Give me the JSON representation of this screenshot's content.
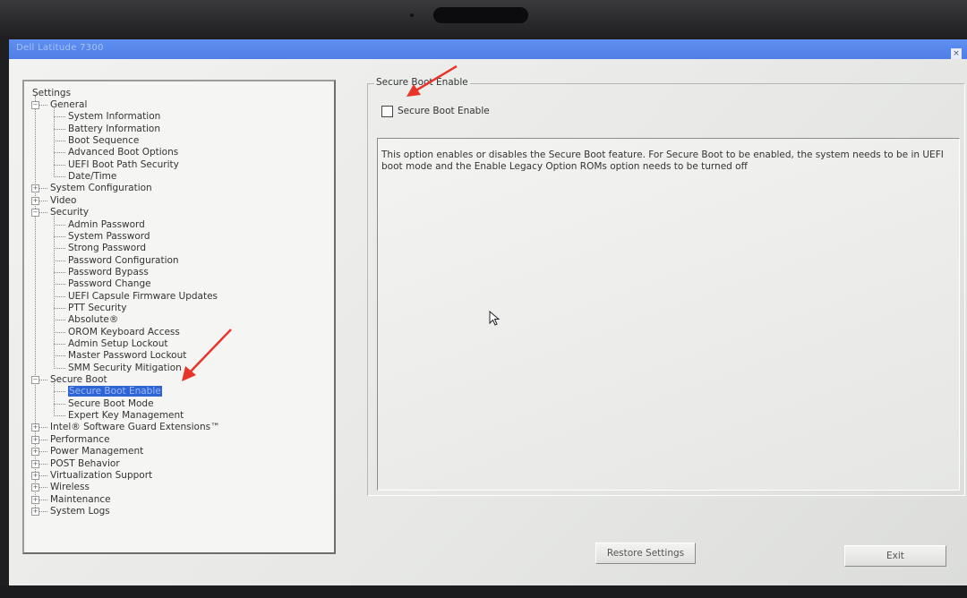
{
  "window": {
    "title": "Dell Latitude 7300"
  },
  "tree": {
    "root_label": "Settings",
    "items": [
      {
        "label": "General",
        "level": 1,
        "expander": "−"
      },
      {
        "label": "System Information",
        "level": 2
      },
      {
        "label": "Battery Information",
        "level": 2
      },
      {
        "label": "Boot Sequence",
        "level": 2
      },
      {
        "label": "Advanced Boot Options",
        "level": 2
      },
      {
        "label": "UEFI Boot Path Security",
        "level": 2
      },
      {
        "label": "Date/Time",
        "level": 2
      },
      {
        "label": "System Configuration",
        "level": 1,
        "expander": "+"
      },
      {
        "label": "Video",
        "level": 1,
        "expander": "+"
      },
      {
        "label": "Security",
        "level": 1,
        "expander": "−"
      },
      {
        "label": "Admin Password",
        "level": 2
      },
      {
        "label": "System Password",
        "level": 2
      },
      {
        "label": "Strong Password",
        "level": 2
      },
      {
        "label": "Password Configuration",
        "level": 2
      },
      {
        "label": "Password Bypass",
        "level": 2
      },
      {
        "label": "Password Change",
        "level": 2
      },
      {
        "label": "UEFI Capsule Firmware Updates",
        "level": 2
      },
      {
        "label": "PTT Security",
        "level": 2
      },
      {
        "label": "Absolute®",
        "level": 2
      },
      {
        "label": "OROM Keyboard Access",
        "level": 2
      },
      {
        "label": "Admin Setup Lockout",
        "level": 2
      },
      {
        "label": "Master Password Lockout",
        "level": 2
      },
      {
        "label": "SMM Security Mitigation",
        "level": 2
      },
      {
        "label": "Secure Boot",
        "level": 1,
        "expander": "−"
      },
      {
        "label": "Secure Boot Enable",
        "level": 2,
        "selected": true
      },
      {
        "label": "Secure Boot Mode",
        "level": 2
      },
      {
        "label": "Expert Key Management",
        "level": 2
      },
      {
        "label": "Intel® Software Guard Extensions™",
        "level": 1,
        "expander": "+"
      },
      {
        "label": "Performance",
        "level": 1,
        "expander": "+"
      },
      {
        "label": "Power Management",
        "level": 1,
        "expander": "+"
      },
      {
        "label": "POST Behavior",
        "level": 1,
        "expander": "+"
      },
      {
        "label": "Virtualization Support",
        "level": 1,
        "expander": "+"
      },
      {
        "label": "Wireless",
        "level": 1,
        "expander": "+"
      },
      {
        "label": "Maintenance",
        "level": 1,
        "expander": "+"
      },
      {
        "label": "System Logs",
        "level": 1,
        "expander": "+"
      }
    ]
  },
  "panel": {
    "group_title": "Secure Boot Enable",
    "checkbox_label": "Secure Boot Enable",
    "checkbox_checked": false,
    "description": "This option enables or disables the Secure Boot feature. For Secure Boot to be enabled, the system needs to be in UEFI boot mode and the Enable Legacy Option ROMs option needs to be turned off"
  },
  "buttons": {
    "restore_label": "Restore Settings",
    "exit_label": "Exit"
  },
  "colors": {
    "titlebar": "#4f7fe6",
    "selection": "#2f64d6",
    "annotation_arrow": "#e8352b"
  }
}
